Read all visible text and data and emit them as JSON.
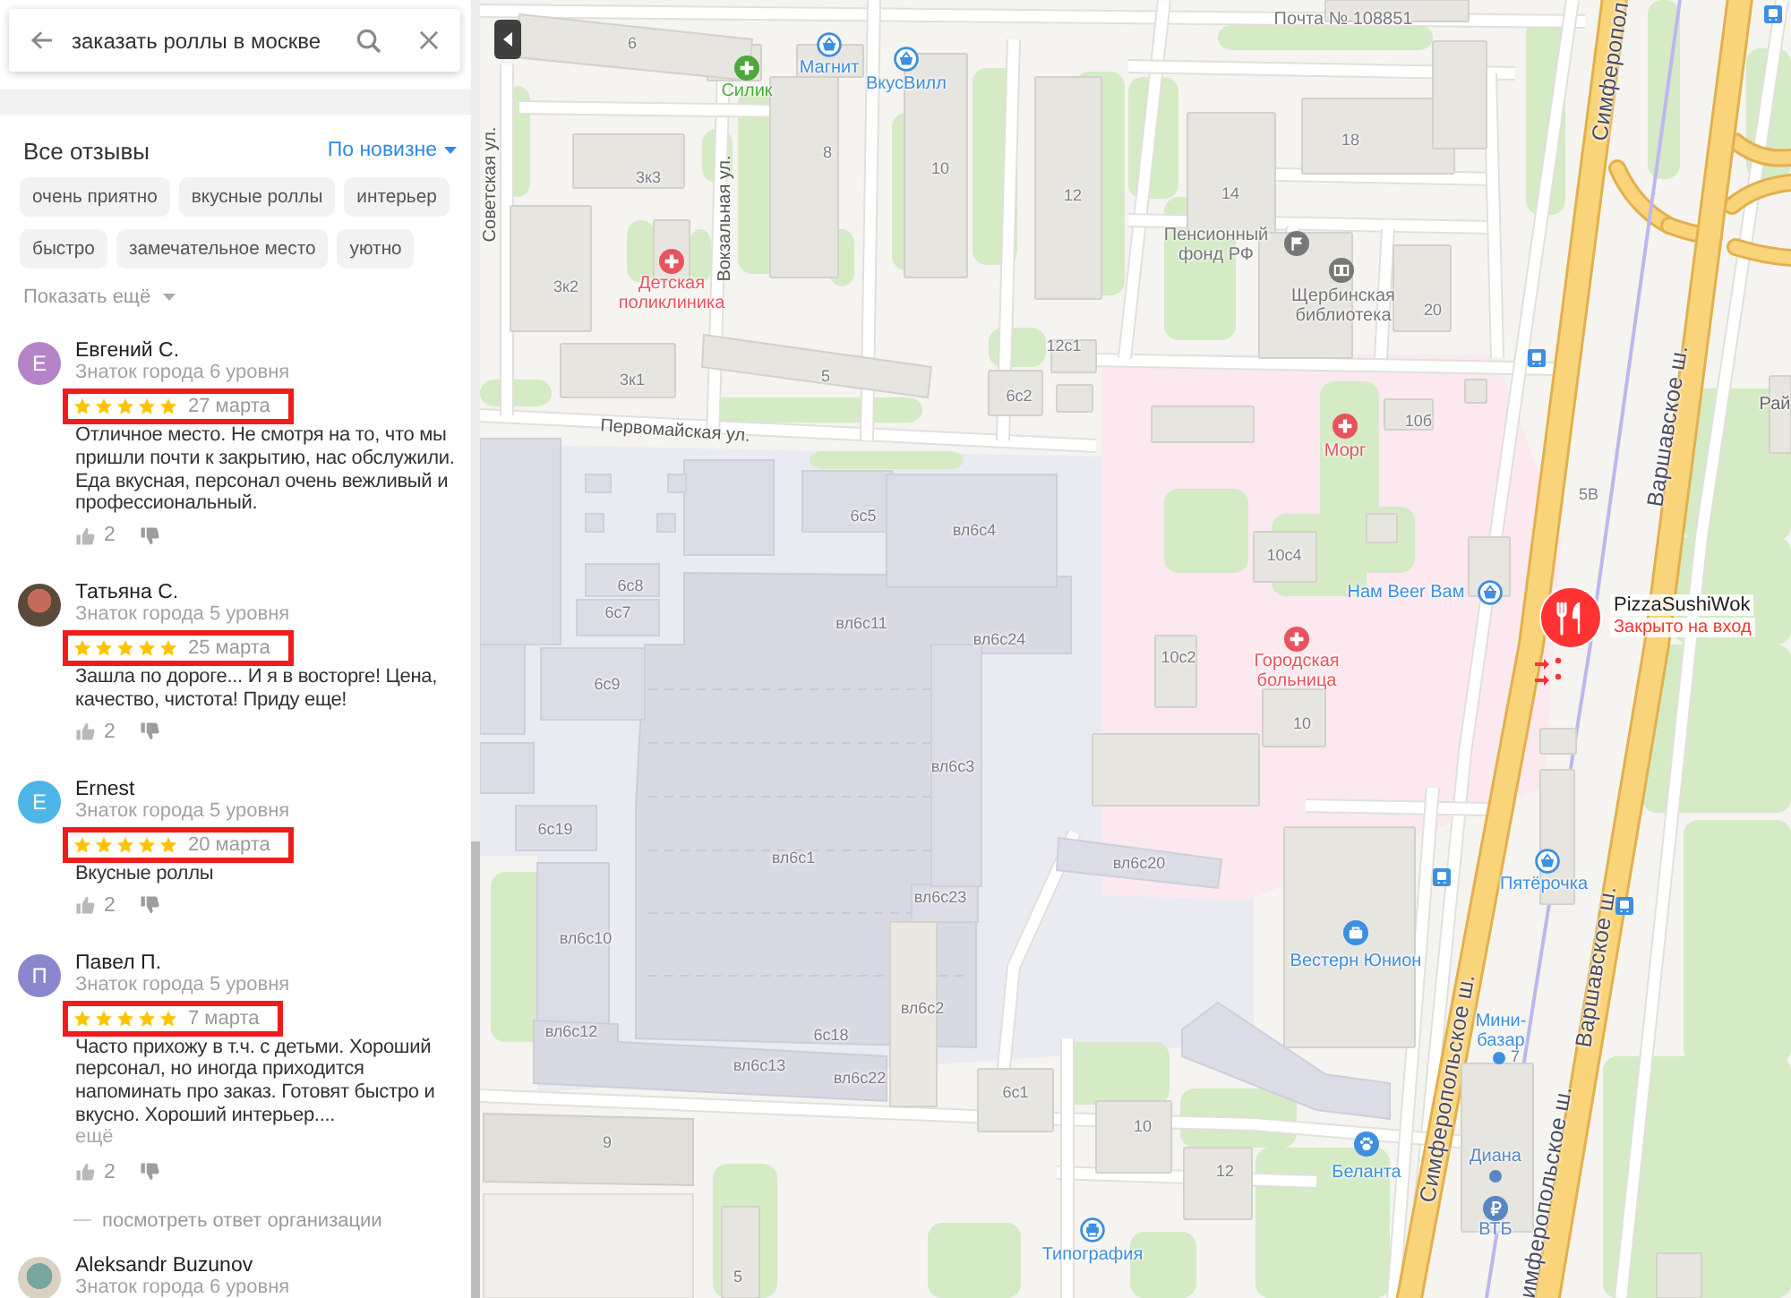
{
  "search": {
    "query": "заказать роллы в москве"
  },
  "reviews_panel": {
    "title": "Все отзывы",
    "sort": "По новизне",
    "tags": [
      {
        "label": "очень приятно",
        "selected": false
      },
      {
        "label": "вкусные роллы",
        "selected": false
      },
      {
        "label": "интерьер",
        "selected": false
      },
      {
        "label": "быстро",
        "selected": false
      },
      {
        "label": "замечательное место",
        "selected": false
      },
      {
        "label": "уютно",
        "selected": false
      }
    ],
    "show_more": "Показать ещё"
  },
  "reviews": [
    {
      "avatar": {
        "kind": "letter",
        "letter": "Е",
        "color": "#b584c7"
      },
      "name": "Евгений С.",
      "level": "Знаток города 6 уровня",
      "stars": 5,
      "date": "27 марта",
      "highlighted": true,
      "text": "Отличное место. Не смотря на то, что мы пришли почти к закрытию, нас обслужили. Еда вкусная, персонал очень вежливый и профессиональный.",
      "likes": "2"
    },
    {
      "avatar": {
        "kind": "photo"
      },
      "name": "Татьяна С.",
      "level": "Знаток города 5 уровня",
      "stars": 5,
      "date": "25 марта",
      "highlighted": true,
      "text": "Зашла по дороге... И я в восторге! Цена, качество, чистота! Приду еще!",
      "likes": "2"
    },
    {
      "avatar": {
        "kind": "letter",
        "letter": "E",
        "color": "#4db6e8"
      },
      "name": "Ernest",
      "level": "Знаток города 5 уровня",
      "stars": 5,
      "date": "20 марта",
      "highlighted": true,
      "text": "Вкусные роллы",
      "likes": "2"
    },
    {
      "avatar": {
        "kind": "letter",
        "letter": "П",
        "color": "#8a87cf"
      },
      "name": "Павел П.",
      "level": "Знаток города 5 уровня",
      "stars": 5,
      "date": "7 марта",
      "highlighted": true,
      "text": "Часто прихожу в т.ч. с детьми. Хороший персонал, но иногда приходится напоминать про заказ. Готовят быстро и вкусно. Хороший интерьер....",
      "more": "ещё",
      "likes": "2",
      "reply_link": "посмотреть ответ организации"
    },
    {
      "avatar": {
        "kind": "photo"
      },
      "name": "Aleksandr Buzunov",
      "level": "Знаток города 6 уровня"
    }
  ],
  "map": {
    "streets": [
      {
        "kind": "highway",
        "name": "Симферопол"
      },
      {
        "kind": "street",
        "name": "Советская ул."
      },
      {
        "kind": "street",
        "name": "Вокзальная ул."
      },
      {
        "kind": "highway",
        "name": "Варшавское ш."
      },
      {
        "kind": "street",
        "name": "Первомайская ул."
      },
      {
        "kind": "highway",
        "name": "Варшавское ш."
      },
      {
        "kind": "highway",
        "name": "Симферопольское ш."
      },
      {
        "kind": "highway",
        "name": "имферопольское ш."
      }
    ],
    "buildings": [
      "6",
      "8",
      "10",
      "3к3",
      "12",
      "18",
      "14",
      "3к2",
      "20",
      "12с1",
      "5",
      "3к1",
      "6с2",
      "10б",
      "5В",
      "6с5",
      "вл6с4",
      "10с4",
      "6с8",
      "6с7",
      "вл6с11",
      "вл6с24",
      "10с2",
      "6с9",
      "10",
      "вл6с3",
      "6с19",
      "вл6с1",
      "вл6с20",
      "вл6с23",
      "вл6с10",
      "вл6с2",
      "вл6с12",
      "6с18",
      "7",
      "вл6с13",
      "вл6с22",
      "6с1",
      "10",
      "9",
      "12",
      "5"
    ],
    "places": [
      {
        "kind": "post",
        "name": "Почта № 108851",
        "color": "#7a7a7a"
      },
      {
        "kind": "shop",
        "name": "Магнит",
        "color": "#3d8fe0"
      },
      {
        "kind": "shop",
        "name": "ВкусВилл",
        "color": "#3d8fe0"
      },
      {
        "kind": "pharmacy",
        "name": "Силик",
        "color": "#4ea83b"
      },
      {
        "kind": "pension",
        "name": "Пенсионный фонд РФ",
        "color": "#777777"
      },
      {
        "kind": "medical",
        "name": "Детская поликлиника",
        "color": "#e9535d"
      },
      {
        "kind": "library",
        "name": "Щербинская библиотека",
        "color": "#777777"
      },
      {
        "kind": "place",
        "name": "Рай",
        "color": "#666666"
      },
      {
        "kind": "medical",
        "name": "Морг",
        "color": "#e9535d"
      },
      {
        "kind": "shop",
        "name": "Нам Beer Вам",
        "color": "#3d8fe0"
      },
      {
        "kind": "medical",
        "name": "Городская больница",
        "color": "#e9535d"
      },
      {
        "kind": "shop",
        "name": "Пятёрочка",
        "color": "#3d8fe0"
      },
      {
        "kind": "office",
        "name": "Вестерн Юнион",
        "color": "#3d8fe0"
      },
      {
        "kind": "dot",
        "name": "Мини-базар",
        "color": "#3d8fe0"
      },
      {
        "kind": "pet",
        "name": "Беланта",
        "color": "#3d8fe0"
      },
      {
        "kind": "dot",
        "name": "Диана",
        "color": "#5a86c4"
      },
      {
        "kind": "bank",
        "name": "ВТБ",
        "color": "#5a86c4"
      },
      {
        "kind": "print",
        "name": "Типография",
        "color": "#3d8fe0"
      }
    ],
    "selected_place": {
      "name": "PizzaSushiWok",
      "status": "Закрыто на вход"
    }
  }
}
